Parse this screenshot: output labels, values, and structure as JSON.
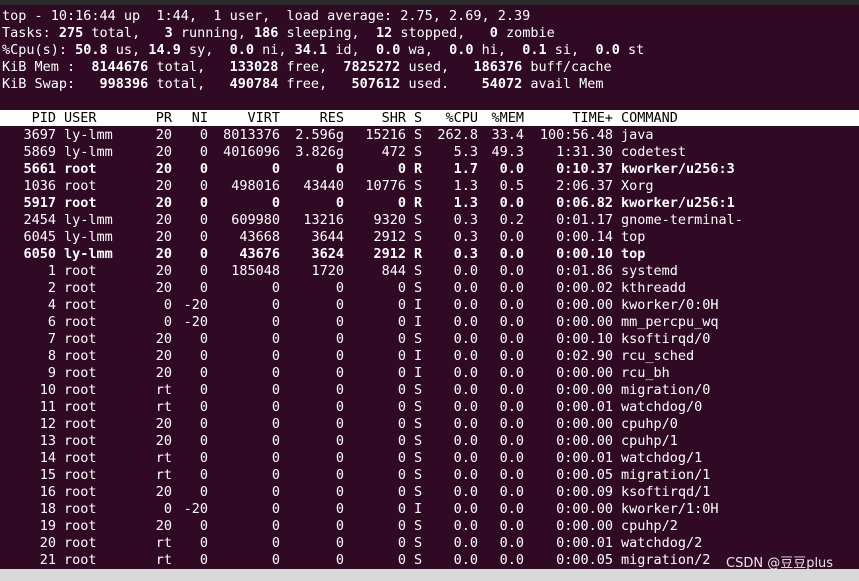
{
  "summary": {
    "line1": [
      {
        "t": "top - 10:16:44 up  1:44,  1 user,  load average: 2.75, 2.69, 2.39",
        "b": false
      }
    ],
    "line2": [
      {
        "t": "Tasks: ",
        "b": false
      },
      {
        "t": "275",
        "b": true
      },
      {
        "t": " total,   ",
        "b": false
      },
      {
        "t": "3",
        "b": true
      },
      {
        "t": " running, ",
        "b": false
      },
      {
        "t": "186",
        "b": true
      },
      {
        "t": " sleeping,  ",
        "b": false
      },
      {
        "t": "12",
        "b": true
      },
      {
        "t": " stopped,   ",
        "b": false
      },
      {
        "t": "0",
        "b": true
      },
      {
        "t": " zombie",
        "b": false
      }
    ],
    "line3": [
      {
        "t": "%Cpu(s): ",
        "b": false
      },
      {
        "t": "50.8",
        "b": true
      },
      {
        "t": " us, ",
        "b": false
      },
      {
        "t": "14.9",
        "b": true
      },
      {
        "t": " sy,  ",
        "b": false
      },
      {
        "t": "0.0",
        "b": true
      },
      {
        "t": " ni, ",
        "b": false
      },
      {
        "t": "34.1",
        "b": true
      },
      {
        "t": " id,  ",
        "b": false
      },
      {
        "t": "0.0",
        "b": true
      },
      {
        "t": " wa,  ",
        "b": false
      },
      {
        "t": "0.0",
        "b": true
      },
      {
        "t": " hi,  ",
        "b": false
      },
      {
        "t": "0.1",
        "b": true
      },
      {
        "t": " si,  ",
        "b": false
      },
      {
        "t": "0.0",
        "b": true
      },
      {
        "t": " st",
        "b": false
      }
    ],
    "line4": [
      {
        "t": "KiB Mem : ",
        "b": false
      },
      {
        "t": " 8144676",
        "b": true
      },
      {
        "t": " total,   ",
        "b": false
      },
      {
        "t": "133028",
        "b": true
      },
      {
        "t": " free,  ",
        "b": false
      },
      {
        "t": "7825272",
        "b": true
      },
      {
        "t": " used,   ",
        "b": false
      },
      {
        "t": "186376",
        "b": true
      },
      {
        "t": " buff/cache",
        "b": false
      }
    ],
    "line5": [
      {
        "t": "KiB Swap: ",
        "b": false
      },
      {
        "t": "  998396",
        "b": true
      },
      {
        "t": " total,   ",
        "b": false
      },
      {
        "t": "490784",
        "b": true
      },
      {
        "t": " free,   ",
        "b": false
      },
      {
        "t": "507612",
        "b": true
      },
      {
        "t": " used.    ",
        "b": false
      },
      {
        "t": "54072",
        "b": true
      },
      {
        "t": " avail Mem",
        "b": false
      }
    ]
  },
  "columns": {
    "pid": "PID",
    "user": "USER",
    "pr": "PR",
    "ni": "NI",
    "virt": "VIRT",
    "res": "RES",
    "shr": "SHR",
    "s": "S",
    "cpu": "%CPU",
    "mem": "%MEM",
    "time": "TIME+",
    "cmd": "COMMAND"
  },
  "processes": [
    {
      "pid": "3697",
      "user": "ly-lmm",
      "pr": "20",
      "ni": "0",
      "virt": "8013376",
      "res": "2.596g",
      "shr": "15216",
      "s": "S",
      "cpu": "262.8",
      "mem": "33.4",
      "time": "100:56.48",
      "cmd": "java",
      "bold": false
    },
    {
      "pid": "5869",
      "user": "ly-lmm",
      "pr": "20",
      "ni": "0",
      "virt": "4016096",
      "res": "3.826g",
      "shr": "472",
      "s": "S",
      "cpu": "5.3",
      "mem": "49.3",
      "time": "1:31.30",
      "cmd": "codetest",
      "bold": false
    },
    {
      "pid": "5661",
      "user": "root",
      "pr": "20",
      "ni": "0",
      "virt": "0",
      "res": "0",
      "shr": "0",
      "s": "R",
      "cpu": "1.7",
      "mem": "0.0",
      "time": "0:10.37",
      "cmd": "kworker/u256:3",
      "bold": true
    },
    {
      "pid": "1036",
      "user": "root",
      "pr": "20",
      "ni": "0",
      "virt": "498016",
      "res": "43440",
      "shr": "10776",
      "s": "S",
      "cpu": "1.3",
      "mem": "0.5",
      "time": "2:06.37",
      "cmd": "Xorg",
      "bold": false
    },
    {
      "pid": "5917",
      "user": "root",
      "pr": "20",
      "ni": "0",
      "virt": "0",
      "res": "0",
      "shr": "0",
      "s": "R",
      "cpu": "1.3",
      "mem": "0.0",
      "time": "0:06.82",
      "cmd": "kworker/u256:1",
      "bold": true
    },
    {
      "pid": "2454",
      "user": "ly-lmm",
      "pr": "20",
      "ni": "0",
      "virt": "609980",
      "res": "13216",
      "shr": "9320",
      "s": "S",
      "cpu": "0.3",
      "mem": "0.2",
      "time": "0:01.17",
      "cmd": "gnome-terminal-",
      "bold": false
    },
    {
      "pid": "6045",
      "user": "ly-lmm",
      "pr": "20",
      "ni": "0",
      "virt": "43668",
      "res": "3644",
      "shr": "2912",
      "s": "S",
      "cpu": "0.3",
      "mem": "0.0",
      "time": "0:00.14",
      "cmd": "top",
      "bold": false
    },
    {
      "pid": "6050",
      "user": "ly-lmm",
      "pr": "20",
      "ni": "0",
      "virt": "43676",
      "res": "3624",
      "shr": "2912",
      "s": "R",
      "cpu": "0.3",
      "mem": "0.0",
      "time": "0:00.10",
      "cmd": "top",
      "bold": true
    },
    {
      "pid": "1",
      "user": "root",
      "pr": "20",
      "ni": "0",
      "virt": "185048",
      "res": "1720",
      "shr": "844",
      "s": "S",
      "cpu": "0.0",
      "mem": "0.0",
      "time": "0:01.86",
      "cmd": "systemd",
      "bold": false
    },
    {
      "pid": "2",
      "user": "root",
      "pr": "20",
      "ni": "0",
      "virt": "0",
      "res": "0",
      "shr": "0",
      "s": "S",
      "cpu": "0.0",
      "mem": "0.0",
      "time": "0:00.02",
      "cmd": "kthreadd",
      "bold": false
    },
    {
      "pid": "4",
      "user": "root",
      "pr": "0",
      "ni": "-20",
      "virt": "0",
      "res": "0",
      "shr": "0",
      "s": "I",
      "cpu": "0.0",
      "mem": "0.0",
      "time": "0:00.00",
      "cmd": "kworker/0:0H",
      "bold": false
    },
    {
      "pid": "6",
      "user": "root",
      "pr": "0",
      "ni": "-20",
      "virt": "0",
      "res": "0",
      "shr": "0",
      "s": "I",
      "cpu": "0.0",
      "mem": "0.0",
      "time": "0:00.00",
      "cmd": "mm_percpu_wq",
      "bold": false
    },
    {
      "pid": "7",
      "user": "root",
      "pr": "20",
      "ni": "0",
      "virt": "0",
      "res": "0",
      "shr": "0",
      "s": "S",
      "cpu": "0.0",
      "mem": "0.0",
      "time": "0:00.10",
      "cmd": "ksoftirqd/0",
      "bold": false
    },
    {
      "pid": "8",
      "user": "root",
      "pr": "20",
      "ni": "0",
      "virt": "0",
      "res": "0",
      "shr": "0",
      "s": "I",
      "cpu": "0.0",
      "mem": "0.0",
      "time": "0:02.90",
      "cmd": "rcu_sched",
      "bold": false
    },
    {
      "pid": "9",
      "user": "root",
      "pr": "20",
      "ni": "0",
      "virt": "0",
      "res": "0",
      "shr": "0",
      "s": "I",
      "cpu": "0.0",
      "mem": "0.0",
      "time": "0:00.00",
      "cmd": "rcu_bh",
      "bold": false
    },
    {
      "pid": "10",
      "user": "root",
      "pr": "rt",
      "ni": "0",
      "virt": "0",
      "res": "0",
      "shr": "0",
      "s": "S",
      "cpu": "0.0",
      "mem": "0.0",
      "time": "0:00.00",
      "cmd": "migration/0",
      "bold": false
    },
    {
      "pid": "11",
      "user": "root",
      "pr": "rt",
      "ni": "0",
      "virt": "0",
      "res": "0",
      "shr": "0",
      "s": "S",
      "cpu": "0.0",
      "mem": "0.0",
      "time": "0:00.01",
      "cmd": "watchdog/0",
      "bold": false
    },
    {
      "pid": "12",
      "user": "root",
      "pr": "20",
      "ni": "0",
      "virt": "0",
      "res": "0",
      "shr": "0",
      "s": "S",
      "cpu": "0.0",
      "mem": "0.0",
      "time": "0:00.00",
      "cmd": "cpuhp/0",
      "bold": false
    },
    {
      "pid": "13",
      "user": "root",
      "pr": "20",
      "ni": "0",
      "virt": "0",
      "res": "0",
      "shr": "0",
      "s": "S",
      "cpu": "0.0",
      "mem": "0.0",
      "time": "0:00.00",
      "cmd": "cpuhp/1",
      "bold": false
    },
    {
      "pid": "14",
      "user": "root",
      "pr": "rt",
      "ni": "0",
      "virt": "0",
      "res": "0",
      "shr": "0",
      "s": "S",
      "cpu": "0.0",
      "mem": "0.0",
      "time": "0:00.01",
      "cmd": "watchdog/1",
      "bold": false
    },
    {
      "pid": "15",
      "user": "root",
      "pr": "rt",
      "ni": "0",
      "virt": "0",
      "res": "0",
      "shr": "0",
      "s": "S",
      "cpu": "0.0",
      "mem": "0.0",
      "time": "0:00.05",
      "cmd": "migration/1",
      "bold": false
    },
    {
      "pid": "16",
      "user": "root",
      "pr": "20",
      "ni": "0",
      "virt": "0",
      "res": "0",
      "shr": "0",
      "s": "S",
      "cpu": "0.0",
      "mem": "0.0",
      "time": "0:00.09",
      "cmd": "ksoftirqd/1",
      "bold": false
    },
    {
      "pid": "18",
      "user": "root",
      "pr": "0",
      "ni": "-20",
      "virt": "0",
      "res": "0",
      "shr": "0",
      "s": "I",
      "cpu": "0.0",
      "mem": "0.0",
      "time": "0:00.00",
      "cmd": "kworker/1:0H",
      "bold": false
    },
    {
      "pid": "19",
      "user": "root",
      "pr": "20",
      "ni": "0",
      "virt": "0",
      "res": "0",
      "shr": "0",
      "s": "S",
      "cpu": "0.0",
      "mem": "0.0",
      "time": "0:00.00",
      "cmd": "cpuhp/2",
      "bold": false
    },
    {
      "pid": "20",
      "user": "root",
      "pr": "rt",
      "ni": "0",
      "virt": "0",
      "res": "0",
      "shr": "0",
      "s": "S",
      "cpu": "0.0",
      "mem": "0.0",
      "time": "0:00.01",
      "cmd": "watchdog/2",
      "bold": false
    },
    {
      "pid": "21",
      "user": "root",
      "pr": "rt",
      "ni": "0",
      "virt": "0",
      "res": "0",
      "shr": "0",
      "s": "S",
      "cpu": "0.0",
      "mem": "0.0",
      "time": "0:00.05",
      "cmd": "migration/2",
      "bold": false
    }
  ],
  "watermark": "CSDN @豆豆plus",
  "colors": {
    "background": "#300a24",
    "text": "#ffffff",
    "header_bg": "#ffffff",
    "header_text": "#000000"
  }
}
